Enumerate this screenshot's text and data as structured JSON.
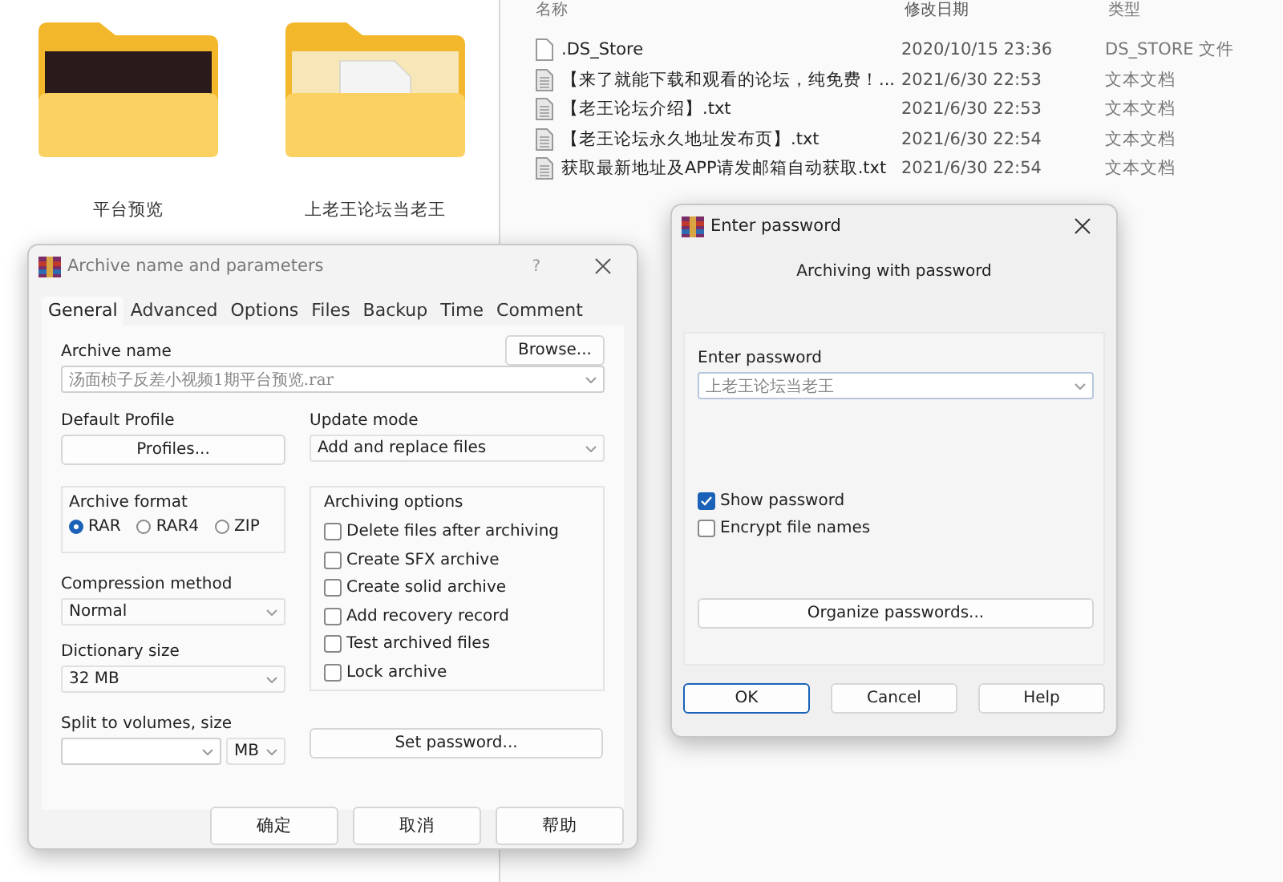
{
  "explorer": {
    "folders": [
      {
        "name": "平台预览",
        "kind": "photo"
      },
      {
        "name": "上老王论坛当老王",
        "kind": "document"
      }
    ],
    "columns": [
      "名称",
      "修改日期",
      "类型"
    ],
    "files": [
      {
        "name": ".DS_Store",
        "modified": "2020/10/15 23:36",
        "type": "DS_STORE 文件",
        "kind": "blank"
      },
      {
        "name": "【来了就能下载和观看的论坛，纯免费！...",
        "modified": "2021/6/30 22:53",
        "type": "文本文档",
        "kind": "text"
      },
      {
        "name": "【老王论坛介绍】.txt",
        "modified": "2021/6/30 22:53",
        "type": "文本文档",
        "kind": "text"
      },
      {
        "name": "【老王论坛永久地址发布页】.txt",
        "modified": "2021/6/30 22:54",
        "type": "文本文档",
        "kind": "text"
      },
      {
        "name": "获取最新地址及APP请发邮箱自动获取.txt",
        "modified": "2021/6/30 22:54",
        "type": "文本文档",
        "kind": "text"
      }
    ]
  },
  "archive_dialog": {
    "title": "Archive name and parameters",
    "help": "?",
    "tabs": [
      {
        "label": "General",
        "selected": true
      },
      {
        "label": "Advanced",
        "selected": false
      },
      {
        "label": "Options",
        "selected": false
      },
      {
        "label": "Files",
        "selected": false
      },
      {
        "label": "Backup",
        "selected": false
      },
      {
        "label": "Time",
        "selected": false
      },
      {
        "label": "Comment",
        "selected": false
      }
    ],
    "archive_name_label": "Archive name",
    "browse": "Browse...",
    "archive_name": "汤面桢子反差小视频1期平台预览.rar",
    "default_profile_label": "Default Profile",
    "profiles": "Profiles...",
    "update_mode_label": "Update mode",
    "update_mode": "Add and replace files",
    "archive_format_label": "Archive format",
    "formats": [
      {
        "label": "RAR",
        "selected": true
      },
      {
        "label": "RAR4",
        "selected": false
      },
      {
        "label": "ZIP",
        "selected": false
      }
    ],
    "archiving_options_label": "Archiving options",
    "options": [
      {
        "label": "Delete files after archiving",
        "checked": false
      },
      {
        "label": "Create SFX archive",
        "checked": false
      },
      {
        "label": "Create solid archive",
        "checked": false
      },
      {
        "label": "Add recovery record",
        "checked": false
      },
      {
        "label": "Test archived files",
        "checked": false
      },
      {
        "label": "Lock archive",
        "checked": false
      }
    ],
    "compression_label": "Compression method",
    "compression": "Normal",
    "dictionary_label": "Dictionary size",
    "dictionary": "32 MB",
    "split_label": "Split to volumes, size",
    "split_unit": "MB",
    "set_password": "Set password...",
    "buttons": [
      {
        "label": "确定",
        "default": false
      },
      {
        "label": "取消",
        "default": false
      },
      {
        "label": "帮助",
        "default": false
      }
    ]
  },
  "password_dialog": {
    "title": "Enter password",
    "heading": "Archiving with password",
    "password_label": "Enter password",
    "password": "上老王论坛当老王",
    "checkboxes": [
      {
        "label": "Show password",
        "checked": true
      },
      {
        "label": "Encrypt file names",
        "checked": false
      }
    ],
    "organize": "Organize passwords...",
    "buttons": [
      {
        "label": "OK",
        "default": true
      },
      {
        "label": "Cancel",
        "default": false
      },
      {
        "label": "Help",
        "default": false
      }
    ]
  }
}
